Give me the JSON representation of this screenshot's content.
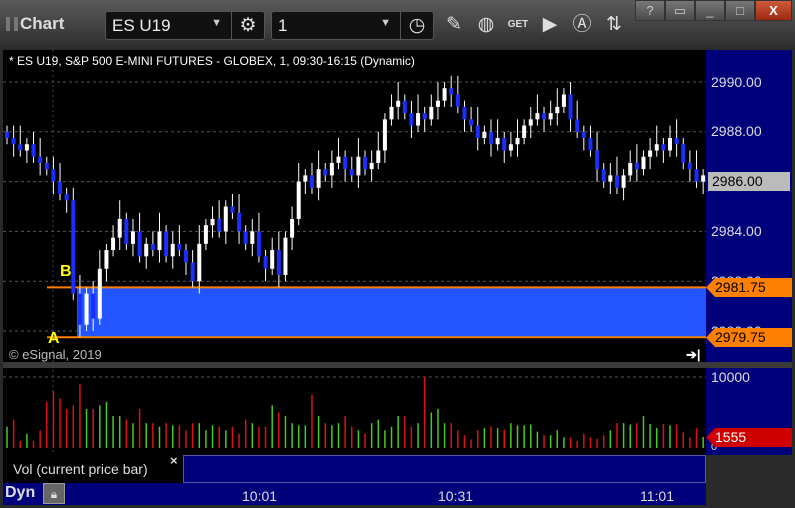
{
  "window": {
    "title": "Chart",
    "symbol": "ES U19",
    "interval": "1",
    "help": "?",
    "min": "_",
    "max": "□",
    "close": "X"
  },
  "toolbar": {
    "icons": [
      "gear-icon",
      "clock-icon",
      "pencil-icon",
      "study-icon",
      "get-icon",
      "play-icon",
      "alert-icon",
      "link-icon"
    ],
    "get_label": "GET"
  },
  "chart": {
    "info": "* ES U19, S&P 500 E-MINI FUTURES - GLOBEX, 1, 09:30-16:15 (Dynamic)",
    "copyright": "© eSignal, 2019",
    "price_labels": [
      "2990.00",
      "2988.00",
      "2986.00",
      "2984.00",
      "2982.00",
      "2980.00"
    ],
    "last_price": "2986.00",
    "zone_high": "2981.75",
    "zone_low": "2979.75",
    "marker_a": "A",
    "marker_b": "B",
    "volume_labels": [
      "10000",
      "0"
    ],
    "last_volume": "1555",
    "study_label": "Vol (current price bar)",
    "study_close": "×",
    "time_labels": [
      "10:01",
      "10:31",
      "11:01"
    ],
    "dyn_label": "Dyn",
    "colors": {
      "up": "#ffffff",
      "down": "#1a2eff",
      "zone": "#2255ff",
      "zone_line": "#ff8000",
      "vol_up": "#44cc22",
      "vol_down": "#dd1111",
      "axis": "#00007a"
    }
  },
  "chart_data": {
    "type": "candlestick",
    "x_first": "09:23",
    "bar_minutes": 1,
    "ylim": [
      2978.5,
      2991
    ],
    "closes": [
      2987.75,
      2987.5,
      2987.25,
      2987.5,
      2987,
      2986.75,
      2986.5,
      2986,
      2985.5,
      2985.25,
      2981.5,
      2980.25,
      2981.5,
      2980.5,
      2982.5,
      2983.25,
      2983.75,
      2984.5,
      2983.5,
      2984,
      2983,
      2983.5,
      2983.25,
      2984,
      2983,
      2983.5,
      2983.25,
      2982.75,
      2982,
      2983.5,
      2984.25,
      2984.5,
      2984,
      2985,
      2984.75,
      2984,
      2983.5,
      2984,
      2983,
      2982.5,
      2983.25,
      2982.25,
      2983.75,
      2984.5,
      2986,
      2986.25,
      2985.75,
      2986.5,
      2986.25,
      2986.75,
      2987,
      2986.5,
      2986.25,
      2987,
      2986.5,
      2986.75,
      2987.25,
      2988.5,
      2989,
      2989.25,
      2988.75,
      2988.25,
      2988.75,
      2988.5,
      2989,
      2989.25,
      2989.75,
      2989.5,
      2989,
      2988.5,
      2988.25,
      2987.75,
      2988,
      2987.5,
      2987.75,
      2987.25,
      2987.5,
      2987.75,
      2988.25,
      2988.5,
      2988.75,
      2988.5,
      2988.75,
      2989,
      2989.5,
      2988.5,
      2988,
      2987.75,
      2987.25,
      2986.5,
      2986,
      2986.25,
      2985.75,
      2986.25,
      2986.75,
      2986.5,
      2987,
      2987.25,
      2987.5,
      2987.25,
      2987.75,
      2987.5,
      2986.75,
      2986.5,
      2986,
      2986.25
    ],
    "volume": [
      3000,
      4000,
      1000,
      2000,
      1000,
      2500,
      6500,
      8000,
      7000,
      5500,
      6000,
      9000,
      5500,
      5500,
      6000,
      6500,
      4500,
      4500,
      4000,
      3500,
      5500,
      3500,
      3500,
      3000,
      3500,
      3200,
      3200,
      2500,
      3500,
      3500,
      2500,
      3200,
      3000,
      2500,
      3000,
      2000,
      4000,
      3500,
      3000,
      3000,
      6000,
      5000,
      4500,
      3500,
      3200,
      3200,
      7500,
      4500,
      3500,
      3200,
      3500,
      4500,
      3000,
      2500,
      2000,
      3500,
      4000,
      2500,
      3000,
      4500,
      4500,
      3000,
      3500,
      10000,
      5000,
      5500,
      3500,
      3500,
      2500,
      1800,
      1200,
      2500,
      2800,
      3000,
      2800,
      2600,
      3500,
      3200,
      3200,
      3300,
      2300,
      1800,
      1800,
      2500,
      1500,
      1500,
      1000,
      2000,
      1500,
      1300,
      1800,
      2500,
      3500,
      3500,
      3300,
      3500,
      4500,
      3400,
      2800,
      3400,
      3200,
      3300,
      2200,
      1500,
      2800,
      1555
    ],
    "vlim": [
      0,
      10000
    ]
  }
}
